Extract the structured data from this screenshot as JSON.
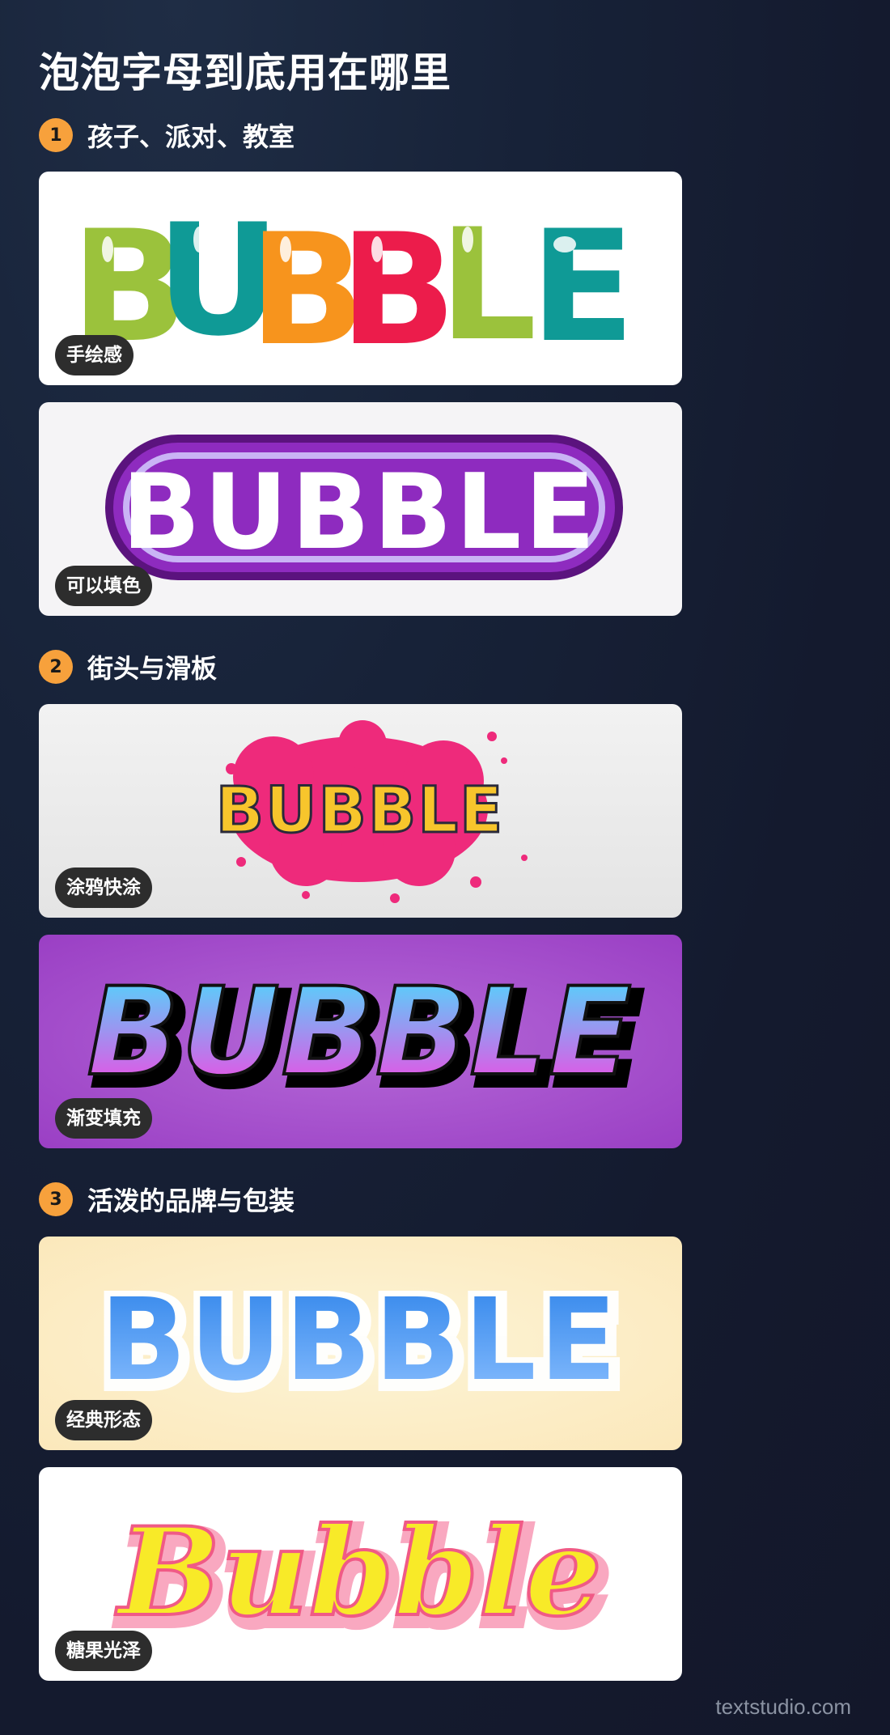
{
  "page_title": "泡泡字母到底用在哪里",
  "sections": [
    {
      "number": "1",
      "title": "孩子、派对、教室"
    },
    {
      "number": "2",
      "title": "街头与滑板"
    },
    {
      "number": "3",
      "title": "活泼的品牌与包装"
    }
  ],
  "cards": [
    {
      "tag": "手绘感",
      "word": "BUBBLE",
      "icon": "bubble-text-hand-drawn-illustration",
      "background": "#ffffff",
      "letter_colors": [
        "#9bc23c",
        "#0f9a96",
        "#f7941d",
        "#ec1c4b",
        "#9bc23c",
        "#0f9a96"
      ]
    },
    {
      "tag": "可以填色",
      "word": "BUBBLE",
      "icon": "bubble-text-outline-illustration",
      "background": "#f5f4f6",
      "fill": "#ffffff",
      "outline": "#7b1fa2"
    },
    {
      "tag": "涂鸦快涂",
      "word": "BUBBLE",
      "icon": "bubble-text-graffiti-illustration",
      "background": "#ececec",
      "fill": "#f7c52c",
      "splash": "#ee2a7b"
    },
    {
      "tag": "渐变填充",
      "word": "BUBBLE",
      "icon": "bubble-text-gradient-illustration",
      "background": "#a452c8",
      "gradient": [
        "#3fe6ff",
        "#ff3de0"
      ]
    },
    {
      "tag": "经典形态",
      "word": "BUBBLE",
      "icon": "bubble-text-classic-illustration",
      "background": "#fcf0c8",
      "gradient": [
        "#3f93f0",
        "#7fb8ff"
      ]
    },
    {
      "tag": "糖果光泽",
      "word": "Bubble",
      "icon": "bubble-text-candy-gloss-illustration",
      "background": "#ffffff",
      "fill": "#f8ea28",
      "outline": "#f36b8e"
    }
  ],
  "watermark": "textstudio.com"
}
